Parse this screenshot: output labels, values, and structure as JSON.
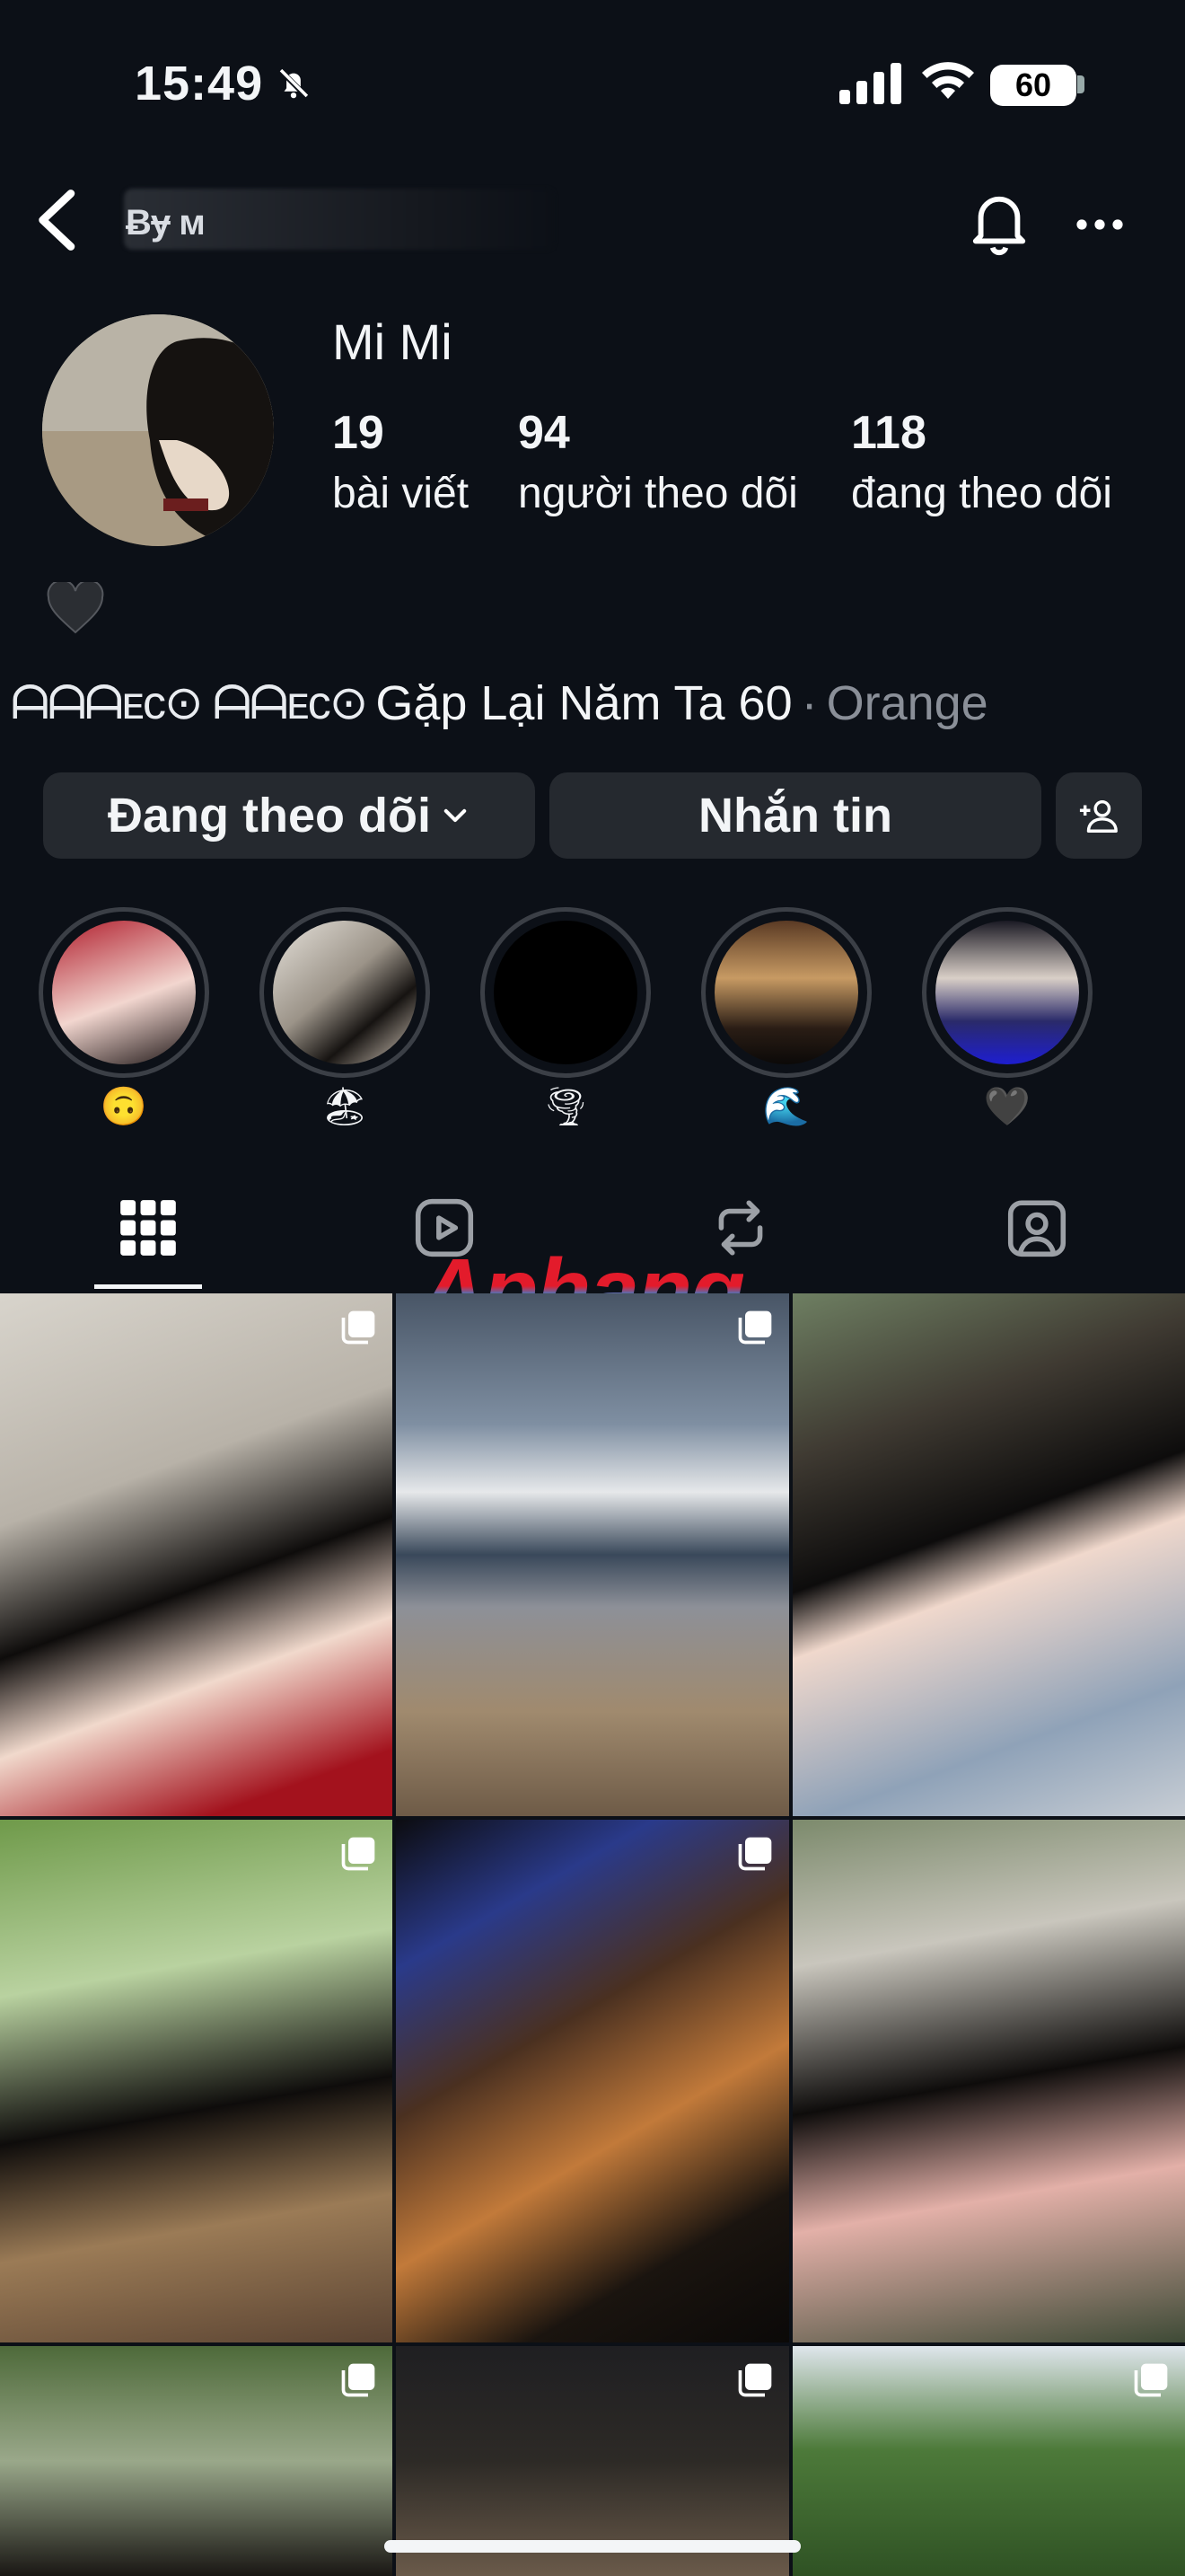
{
  "status_bar": {
    "time": "15:49",
    "battery": "60"
  },
  "header": {
    "username_fragment": "Ƀɏ ᴍ"
  },
  "profile": {
    "display_name": "Mi Mi",
    "posts_count": "19",
    "posts_label": "bài viết",
    "followers_count": "94",
    "followers_label": "người theo dõi",
    "following_count": "118",
    "following_label": "đang theo dõi",
    "bio": "🖤"
  },
  "music": {
    "decor": "ᗩᗩᗩᴇᴄ⊙ ᗩᗩᴇᴄ⊙",
    "song": "Gặp Lại Năm Ta 60",
    "dot": "·",
    "artist": "Orange"
  },
  "actions": {
    "following_label": "Đang theo dõi",
    "message_label": "Nhắn tin"
  },
  "highlights": [
    {
      "emoji": "🙃"
    },
    {
      "emoji": "🏖"
    },
    {
      "emoji": "🌪"
    },
    {
      "emoji": "🌊"
    },
    {
      "emoji": "🖤"
    }
  ],
  "tabs": {
    "icons": [
      "grid-icon",
      "reels-icon",
      "reposts-icon",
      "tagged-icon"
    ],
    "active": "grid-icon"
  },
  "watermark": "Aphang",
  "colors": {
    "background": "#0c1017",
    "button": "#25292f",
    "muted": "#8a8f98"
  }
}
